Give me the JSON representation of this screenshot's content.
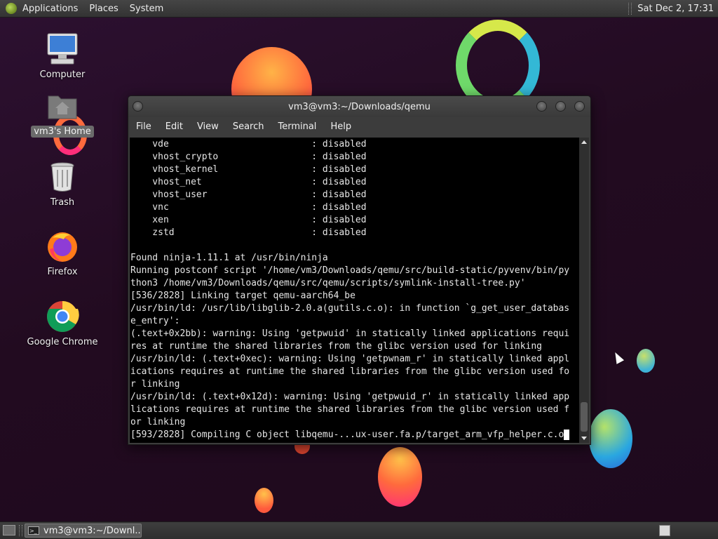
{
  "top_panel": {
    "menus": [
      "Applications",
      "Places",
      "System"
    ],
    "clock": "Sat Dec  2, 17:31"
  },
  "desktop_icons": [
    {
      "label": "Computer",
      "icon": "computer-icon"
    },
    {
      "label": "vm3's Home",
      "icon": "home-folder-icon",
      "selected": true
    },
    {
      "label": "Trash",
      "icon": "trash-icon"
    },
    {
      "label": "Firefox",
      "icon": "firefox-icon"
    },
    {
      "label": "Google Chrome",
      "icon": "chrome-icon"
    }
  ],
  "terminal": {
    "title": "vm3@vm3:~/Downloads/qemu",
    "menu": [
      "File",
      "Edit",
      "View",
      "Search",
      "Terminal",
      "Help"
    ],
    "lines": [
      "    vde                          : disabled",
      "    vhost_crypto                 : disabled",
      "    vhost_kernel                 : disabled",
      "    vhost_net                    : disabled",
      "    vhost_user                   : disabled",
      "    vnc                          : disabled",
      "    xen                          : disabled",
      "    zstd                         : disabled",
      "",
      "Found ninja-1.11.1 at /usr/bin/ninja",
      "Running postconf script '/home/vm3/Downloads/qemu/src/build-static/pyvenv/bin/py",
      "thon3 /home/vm3/Downloads/qemu/src/qemu/scripts/symlink-install-tree.py'",
      "[536/2828] Linking target qemu-aarch64_be",
      "/usr/bin/ld: /usr/lib/libglib-2.0.a(gutils.c.o): in function `g_get_user_databas",
      "e_entry':",
      "(.text+0x2bb): warning: Using 'getpwuid' in statically linked applications requi",
      "res at runtime the shared libraries from the glibc version used for linking",
      "/usr/bin/ld: (.text+0xec): warning: Using 'getpwnam_r' in statically linked appl",
      "ications requires at runtime the shared libraries from the glibc version used fo",
      "r linking",
      "/usr/bin/ld: (.text+0x12d): warning: Using 'getpwuid_r' in statically linked app",
      "lications requires at runtime the shared libraries from the glibc version used f",
      "or linking",
      "[593/2828] Compiling C object libqemu-...ux-user.fa.p/target_arm_vfp_helper.c.o"
    ]
  },
  "taskbar": {
    "task_label": "vm3@vm3:~/Downl..."
  }
}
